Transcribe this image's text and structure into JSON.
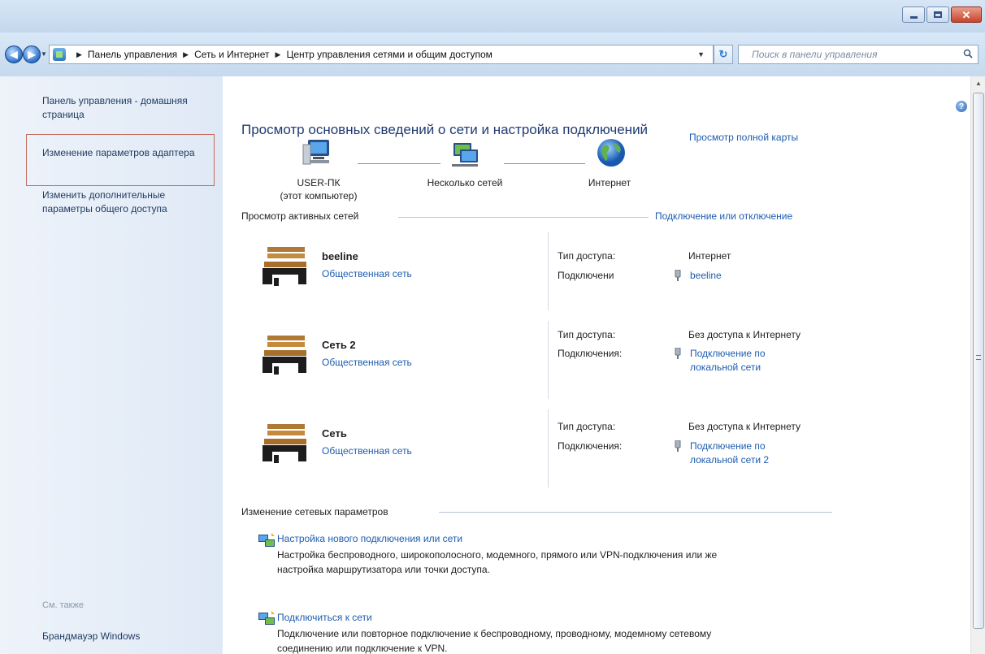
{
  "window": {
    "minimize_icon": "minimize-icon",
    "maximize_icon": "maximize-icon",
    "close_glyph": "✕"
  },
  "address_bar": {
    "back_glyph": "◀",
    "forward_glyph": "▶",
    "breadcrumbs": [
      "Панель управления",
      "Сеть и Интернет",
      "Центр управления сетями и общим доступом"
    ],
    "refresh_glyph": "↻",
    "search_placeholder": "Поиск в панели управления"
  },
  "sidebar": {
    "links": [
      {
        "label": "Панель управления - домашняя страница"
      },
      {
        "label": "Изменение параметров адаптера",
        "selected": true
      },
      {
        "label": "Изменить дополнительные параметры общего доступа"
      }
    ],
    "see_also_label": "См. также",
    "firewall_label": "Брандмауэр Windows"
  },
  "main": {
    "help_glyph": "?",
    "title": "Просмотр основных сведений о сети и настройка подключений",
    "full_map_link": "Просмотр полной карты",
    "map": {
      "computer_label": "USER-ПК",
      "computer_sub": "(этот компьютер)",
      "middle_label": "Несколько сетей",
      "internet_label": "Интернет"
    },
    "active_networks": {
      "heading": "Просмотр активных сетей",
      "connect_link": "Подключение или отключение",
      "access_type_label": "Тип доступа:",
      "items": [
        {
          "name": "beeline",
          "type": "Общественная сеть",
          "access_type": "Интернет",
          "connections_label": "Подключени",
          "connection": "beeline"
        },
        {
          "name": "Сеть  2",
          "type": "Общественная сеть",
          "access_type": "Без доступа к Интернету",
          "connections_label": "Подключения:",
          "connection": "Подключение по локальной сети"
        },
        {
          "name": "Сеть",
          "type": "Общественная сеть",
          "access_type": "Без доступа к Интернету",
          "connections_label": "Подключения:",
          "connection": "Подключение по локальной сети 2"
        }
      ]
    },
    "change_settings": {
      "heading": "Изменение сетевых параметров",
      "tasks": [
        {
          "title": "Настройка нового подключения или сети",
          "description": "Настройка беспроводного, широкополосного, модемного, прямого или VPN-подключения или же настройка маршрутизатора или точки доступа."
        },
        {
          "title": "Подключиться к сети",
          "description": "Подключение или повторное подключение к беспроводному, проводному, модемному сетевому соединению или подключение к VPN."
        }
      ]
    }
  },
  "colors": {
    "link": "#1d5cb0",
    "title": "#1f3b72",
    "sidebar_bg": "#eef3fa",
    "selection_border": "#c46a5c"
  }
}
